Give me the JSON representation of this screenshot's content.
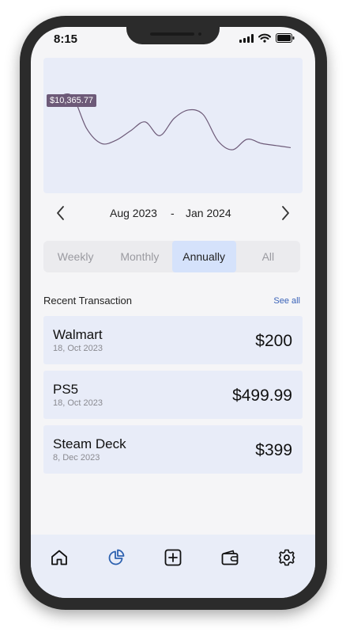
{
  "status_bar": {
    "time": "8:15"
  },
  "chart_data": {
    "type": "line",
    "x": [
      0,
      1,
      2,
      3,
      4,
      5,
      6,
      7,
      8,
      9,
      10,
      11,
      12,
      13,
      14,
      15,
      16
    ],
    "values": [
      10365.77,
      10410,
      8850,
      8150,
      8300,
      8750,
      9180,
      8520,
      9350,
      9750,
      9520,
      8280,
      7850,
      8350,
      8150,
      8050,
      7950
    ],
    "tooltip": {
      "index": 0,
      "label": "$10,365.77"
    },
    "line_color": "#6d5a78",
    "background": "#e8ecf8"
  },
  "range": {
    "start": "Aug 2023",
    "separator": "-",
    "end": "Jan 2024"
  },
  "tabs": [
    {
      "label": "Weekly",
      "active": false
    },
    {
      "label": "Monthly",
      "active": false
    },
    {
      "label": "Annually",
      "active": true
    },
    {
      "label": "All",
      "active": false
    }
  ],
  "recent": {
    "title": "Recent Transaction",
    "see_all": "See all"
  },
  "transactions": [
    {
      "name": "Walmart",
      "date": "18, Oct 2023",
      "amount": "$200"
    },
    {
      "name": "PS5",
      "date": "18, Oct 2023",
      "amount": "$499.99"
    },
    {
      "name": "Steam Deck",
      "date": "8, Dec 2023",
      "amount": "$399"
    }
  ],
  "nav": {
    "items": [
      {
        "icon": "home-icon"
      },
      {
        "icon": "pie-chart-icon",
        "active": true
      },
      {
        "icon": "add-square-icon"
      },
      {
        "icon": "wallet-icon"
      },
      {
        "icon": "gear-icon"
      }
    ],
    "active_color": "#2e62b0",
    "icon_color": "#111111"
  }
}
